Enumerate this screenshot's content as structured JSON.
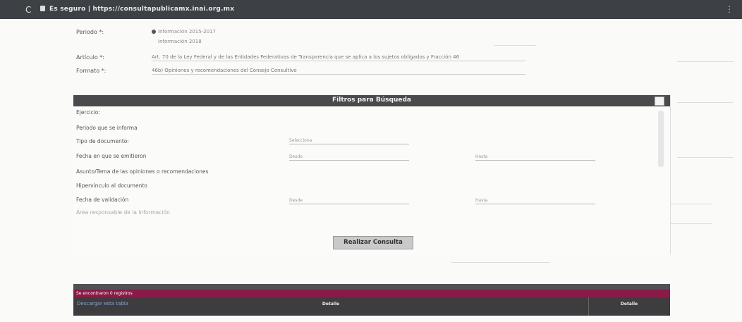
{
  "browser": {
    "url": "Es seguro | https://consultapublicamx.inai.org.mx"
  },
  "form": {
    "periodo_label": "Periodo *:",
    "periodo_options": [
      "Información 2015-2017",
      "Información 2018"
    ],
    "articulo_label": "Artículo *:",
    "articulo_value": "Art. 70 de la Ley Federal y de las Entidades Federativas de Transparencia que se aplica a los sujetos obligados y Fracción 46",
    "formato_label": "Formato *:",
    "formato_value": "46b) Opiniones y recomendaciones del Consejo Consultivo"
  },
  "modal": {
    "title": "Filtros para Búsqueda",
    "filters": [
      "Ejercicio:",
      "Periodo que se informa",
      "Tipo de documento:",
      "Fecha en que se emitieron",
      "Asunto/Tema de las opiniones o recomendaciones",
      "Hipervínculo al documento",
      "Fecha de validación",
      "Área responsable de la información"
    ],
    "tipo_documento_value": "Selecciona",
    "desde_label": "Desde",
    "hasta_label": "Hasta"
  },
  "search_button_label": "Realizar Consulta",
  "results": {
    "count_text": "Se encontraron 0 registros",
    "col_left": "Detalle",
    "col_right": "Detalle"
  },
  "footer_link": "Descargar esta tabla"
}
